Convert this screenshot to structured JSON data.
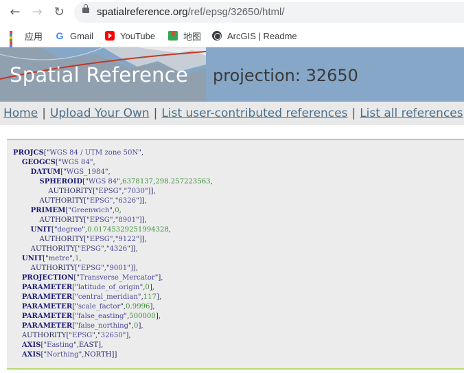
{
  "browser": {
    "url_host": "spatialreference.org",
    "url_path": "/ref/epsg/32650/html/",
    "bookmarks": [
      {
        "label": "应用",
        "icon": "apps-icon"
      },
      {
        "label": "Gmail",
        "icon": "google-icon"
      },
      {
        "label": "YouTube",
        "icon": "youtube-icon"
      },
      {
        "label": "地图",
        "icon": "maps-icon"
      },
      {
        "label": "ArcGIS | Readme",
        "icon": "arcgis-icon"
      }
    ]
  },
  "header": {
    "site_title": "Spatial Reference",
    "page_heading": "projection: 32650"
  },
  "nav": {
    "links": [
      "Home",
      "Upload Your Own",
      "List user-contributed references",
      "List all references"
    ],
    "separator": "|"
  },
  "wkt": {
    "projcs_name": "WGS 84 / UTM zone 50N",
    "geogcs_name": "WGS 84",
    "datum_name": "WGS_1984",
    "spheroid_name": "WGS 84",
    "spheroid_a": "6378137",
    "spheroid_rf": "298.257223563",
    "spheroid_authority": [
      "EPSG",
      "7030"
    ],
    "datum_authority": [
      "EPSG",
      "6326"
    ],
    "primem_name": "Greenwich",
    "primem_value": "0",
    "primem_authority": [
      "EPSG",
      "8901"
    ],
    "angunit_name": "degree",
    "angunit_value": "0.01745329251994328",
    "angunit_authority": [
      "EPSG",
      "9122"
    ],
    "geogcs_authority": [
      "EPSG",
      "4326"
    ],
    "unit_name": "metre",
    "unit_value": "1",
    "unit_authority": [
      "EPSG",
      "9001"
    ],
    "projection": "Transverse_Mercator",
    "parameters": [
      {
        "name": "latitude_of_origin",
        "value": "0"
      },
      {
        "name": "central_meridian",
        "value": "117"
      },
      {
        "name": "scale_factor",
        "value": "0.9996"
      },
      {
        "name": "false_easting",
        "value": "500000"
      },
      {
        "name": "false_northing",
        "value": "0"
      }
    ],
    "authority": [
      "EPSG",
      "32650"
    ],
    "axes": [
      {
        "name": "Easting",
        "dir": "EAST"
      },
      {
        "name": "Northing",
        "dir": "NORTH"
      }
    ]
  },
  "colors": {
    "banner": "#86a7c7",
    "nav_bg": "#e9e9e9",
    "link": "#4a6f8a",
    "wkt_border": "#b7d873",
    "keyword": "#1c1c78",
    "number": "#3f8f3f"
  }
}
